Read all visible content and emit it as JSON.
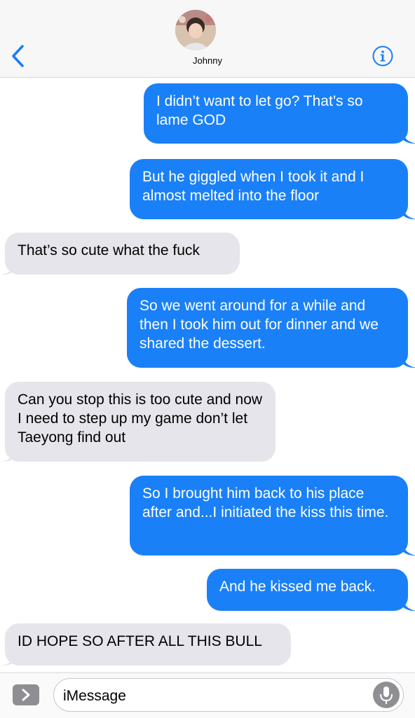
{
  "header": {
    "contact_name": "Johnny",
    "back_icon": "chevron-left-icon",
    "info_icon": "info-icon"
  },
  "messages": [
    {
      "direction": "outgoing",
      "text": "I didn’t want to let go? That’s so lame GOD"
    },
    {
      "direction": "outgoing",
      "text": "But he giggled when I took it and I almost melted into the floor"
    },
    {
      "direction": "incoming",
      "text": "That’s so cute what the fuck"
    },
    {
      "direction": "outgoing",
      "text": "So we went around for a while and then I took him out for dinner and we shared the dessert."
    },
    {
      "direction": "incoming",
      "text": "Can you stop this is too cute and now I need to step up my game don’t let Taeyong find out"
    },
    {
      "direction": "outgoing",
      "text": "So I brought him back to his place after and...I initiated the kiss this time."
    },
    {
      "direction": "outgoing",
      "text": "And he kissed me back."
    },
    {
      "direction": "incoming",
      "text": "ID HOPE SO AFTER ALL THIS BULL"
    }
  ],
  "input": {
    "placeholder": "iMessage",
    "apps_icon": "chevron-right-icon",
    "mic_icon": "microphone-icon"
  },
  "colors": {
    "outgoing_bubble": "#1a80f8",
    "incoming_bubble": "#e6e5eb",
    "accent": "#1a7cf5"
  }
}
